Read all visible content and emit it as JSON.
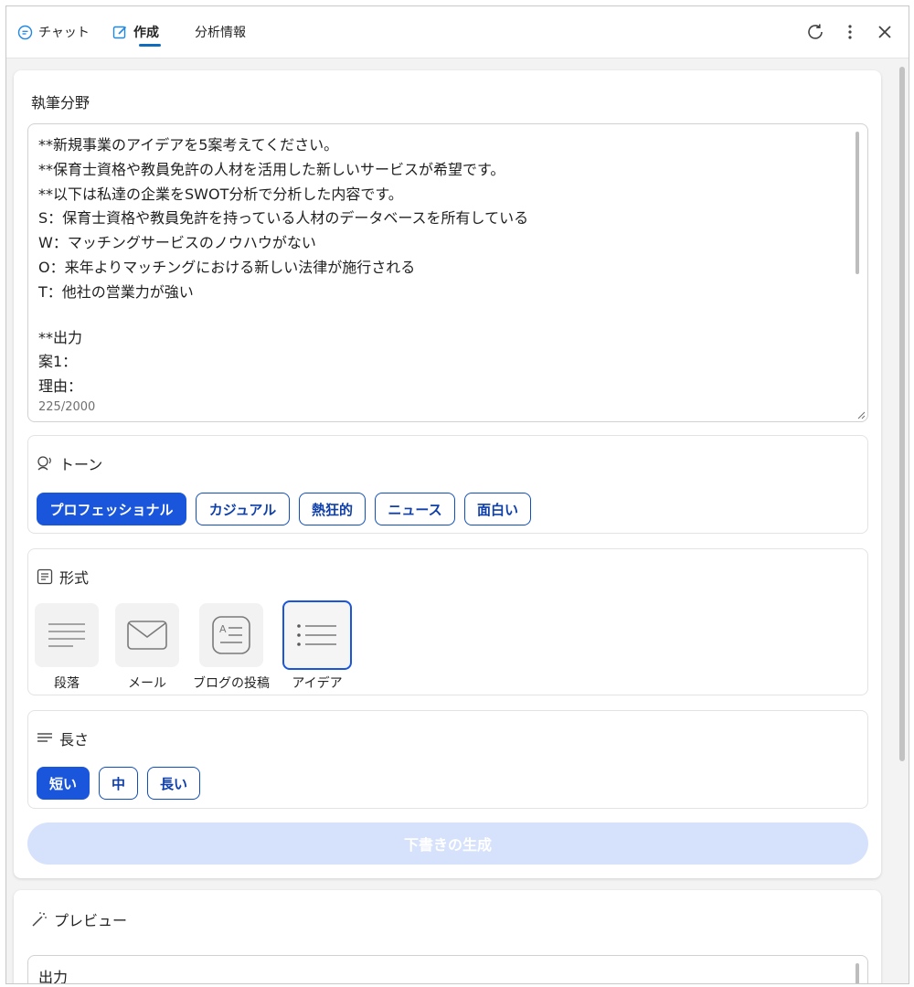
{
  "header": {
    "tabs": [
      {
        "label": "チャット",
        "icon": "chat-icon"
      },
      {
        "label": "作成",
        "icon": "compose-icon",
        "selected": true
      },
      {
        "label": "分析情報"
      }
    ],
    "actions": [
      "refresh-icon",
      "more-icon",
      "close-icon"
    ]
  },
  "compose": {
    "topic_label": "執筆分野",
    "prompt_lines": [
      "**新規事業のアイデアを5案考えてください。",
      "**保育士資格や教員免許の人材を活用した新しいサービスが希望です。",
      "**以下は私達の企業をSWOT分析で分析した内容です。",
      "S：保育士資格や教員免許を持っている人材のデータベースを所有している",
      "W：マッチングサービスのノウハウがない",
      "O：来年よりマッチングにおける新しい法律が施行される",
      "T：他社の営業力が強い",
      "",
      "**出力",
      "案1：",
      "理由："
    ],
    "char_count": "225/2000",
    "tone": {
      "label": "トーン",
      "options": [
        "プロフェッショナル",
        "カジュアル",
        "熱狂的",
        "ニュース",
        "面白い"
      ],
      "selected": "プロフェッショナル"
    },
    "format": {
      "label": "形式",
      "options": [
        {
          "label": "段落",
          "icon": "paragraph-icon"
        },
        {
          "label": "メール",
          "icon": "email-icon"
        },
        {
          "label": "ブログの投稿",
          "icon": "blog-post-icon"
        },
        {
          "label": "アイデア",
          "icon": "ideas-list-icon"
        }
      ],
      "selected": "アイデア"
    },
    "length": {
      "label": "長さ",
      "options": [
        "短い",
        "中",
        "長い"
      ],
      "selected": "短い"
    },
    "generate_label": "下書きの生成"
  },
  "preview": {
    "title": "プレビュー",
    "output_label": "出力"
  },
  "colors": {
    "accent": "#1a56db",
    "tab_indicator": "#0f6cbd",
    "disabled_button": "#d6e2fb"
  }
}
